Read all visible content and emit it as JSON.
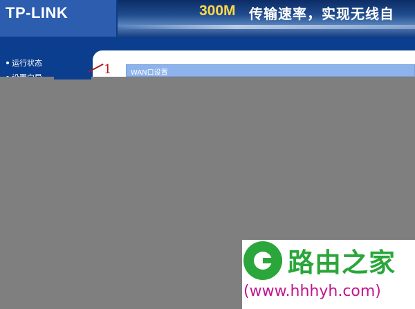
{
  "header": {
    "logo_text": "TP-LINK",
    "slogan_number": "300M",
    "slogan_text": "传输速率，实现无线自"
  },
  "sidebar": {
    "items": [
      {
        "label": "运行状态"
      },
      {
        "label": "设置向导"
      }
    ]
  },
  "main": {
    "section_title": "WAN口设置",
    "annotation_number": "1"
  },
  "watermark": {
    "site_name": "路由之家",
    "url": "(www.hhhyh.com)"
  },
  "colors": {
    "header_blue": "#0d3d86",
    "wan_bar": "#8eb3ec",
    "overlay_gray": "#7f7f7f",
    "watermark_green": "#2aa63a",
    "watermark_url": "#c0158d",
    "annotation_red": "#b11a1a"
  }
}
